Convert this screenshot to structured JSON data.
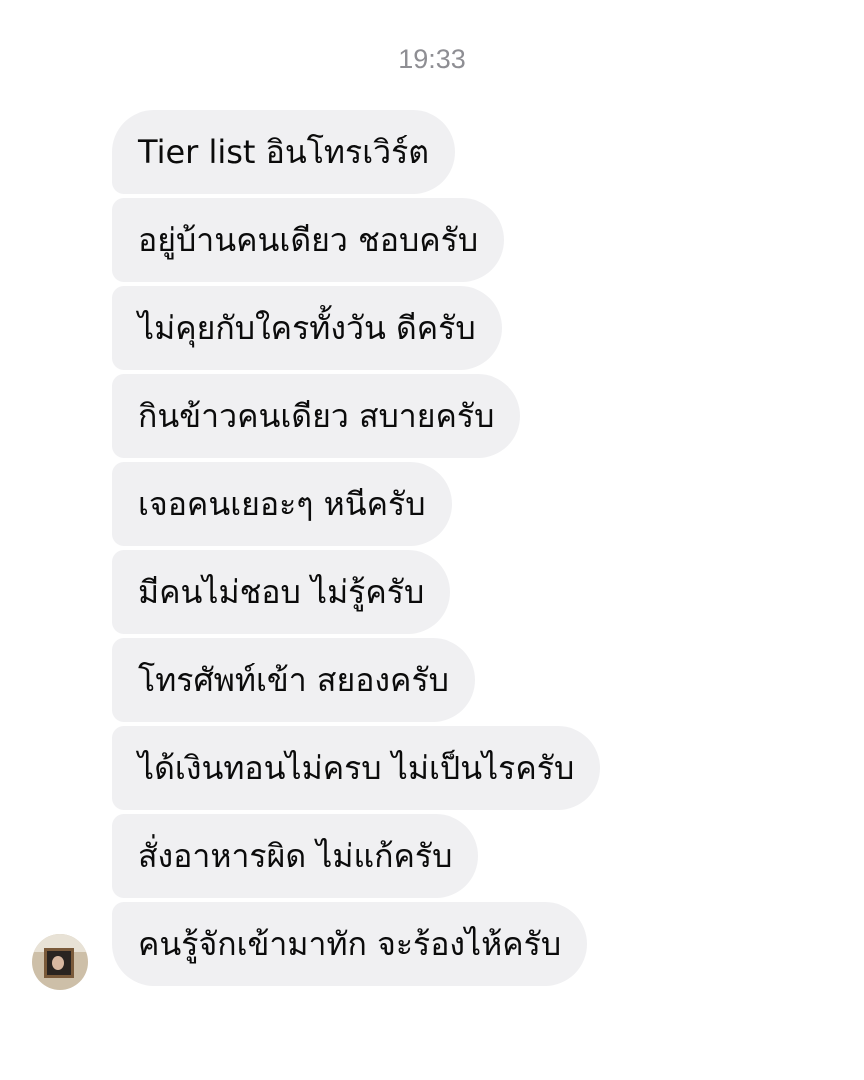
{
  "chat": {
    "timestamp": "19:33",
    "messages": [
      "Tier list อินโทรเวิร์ต",
      "อยู่บ้านคนเดียว ชอบครับ",
      "ไม่คุยกับใครทั้งวัน ดีครับ",
      "กินข้าวคนเดียว สบายครับ",
      "เจอคนเยอะๆ หนีครับ",
      "มีคนไม่ชอบ ไม่รู้ครับ",
      "โทรศัพท์เข้า สยองครับ",
      "ได้เงินทอนไม่ครบ ไม่เป็นไรครับ",
      "สั่งอาหารผิด ไม่แก้ครับ",
      "คนรู้จักเข้ามาทัก จะร้องไห้ครับ"
    ]
  },
  "colors": {
    "bubble_bg": "#f0f0f2",
    "text": "#0b0b0b",
    "timestamp": "#8e8e93"
  }
}
